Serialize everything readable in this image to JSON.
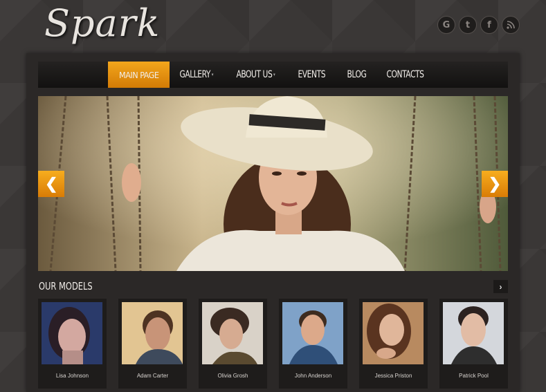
{
  "brand": {
    "logo_text": "Spark"
  },
  "social": [
    {
      "icon": "google-icon",
      "glyph": "G"
    },
    {
      "icon": "twitter-icon",
      "glyph": "t"
    },
    {
      "icon": "facebook-icon",
      "glyph": "f"
    },
    {
      "icon": "rss-icon",
      "glyph": ")"
    }
  ],
  "nav": {
    "items": [
      {
        "label": "MAIN PAGE",
        "active": true,
        "dropdown": false
      },
      {
        "label": "GALLERY",
        "active": false,
        "dropdown": true
      },
      {
        "label": "ABOUT US",
        "active": false,
        "dropdown": true
      },
      {
        "label": "EVENTS",
        "active": false,
        "dropdown": false
      },
      {
        "label": "BLOG",
        "active": false,
        "dropdown": false
      },
      {
        "label": "CONTACTS",
        "active": false,
        "dropdown": false
      }
    ]
  },
  "slider": {
    "prev_glyph": "❯",
    "next_glyph": "❯"
  },
  "models_section": {
    "title": "OUR MODELS",
    "next_glyph": "›",
    "models": [
      {
        "name": "Lisa Johnson"
      },
      {
        "name": "Adam Carter"
      },
      {
        "name": "Olivia Grosh"
      },
      {
        "name": "John Anderson"
      },
      {
        "name": "Jessica Priston"
      },
      {
        "name": "Patrick Pool"
      }
    ]
  },
  "colors": {
    "accent": "#e48f0f",
    "panel": "#2b2827",
    "background": "#3a3736"
  }
}
